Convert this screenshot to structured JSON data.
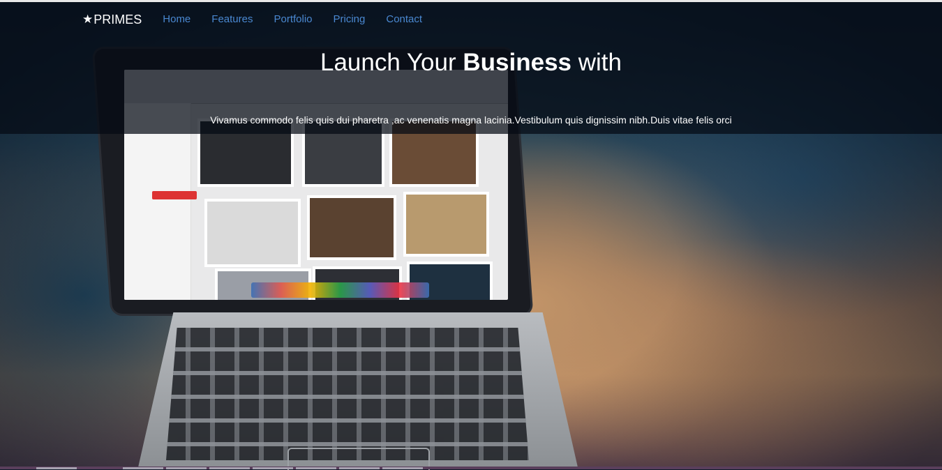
{
  "navbar": {
    "brand_icon": "star-icon",
    "brand_label": "PRIMES",
    "links": [
      {
        "label": "Home"
      },
      {
        "label": "Features"
      },
      {
        "label": "Portfolio"
      },
      {
        "label": "Pricing"
      },
      {
        "label": "Contact"
      }
    ],
    "link_color": "#4a88d1"
  },
  "hero": {
    "headline_prefix": "Launch Your",
    "headline_bold": "Business",
    "headline_suffix": "with",
    "subtext": "Vivamus commodo felis quis dui pharetra ,ac venenatis magna lacinia.Vestibulum quis dignissim nibh.Duis vitae felis orci",
    "background_image": "laptop-on-wooden-table-photo"
  }
}
